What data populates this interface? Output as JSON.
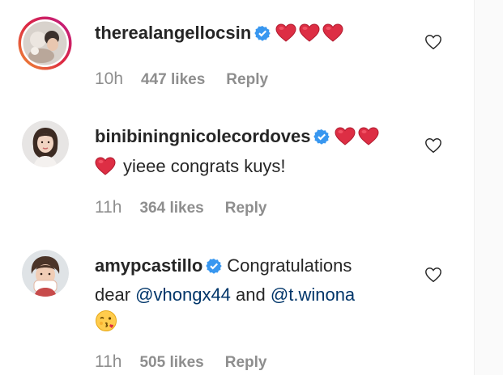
{
  "comments": [
    {
      "username": "therealangellocsin",
      "text": "",
      "time": "10h",
      "likes": "447 likes",
      "reply": "Reply",
      "avatar_icon": "avatar-photo-icon",
      "story_ring": true
    },
    {
      "username": "binibiningnicolecordoves",
      "text": "yieee congrats kuys!",
      "time": "11h",
      "likes": "364 likes",
      "reply": "Reply",
      "avatar_icon": "avatar-photo-icon",
      "story_ring": false
    },
    {
      "username": "amypcastillo",
      "text_1": "Congratulations",
      "text_2": "dear",
      "mention_1": "@vhongx44",
      "text_and": "and",
      "mention_2": "@t.winona",
      "time": "11h",
      "likes": "505 likes",
      "reply": "Reply",
      "avatar_icon": "avatar-photo-icon",
      "story_ring": false
    }
  ],
  "icons": {
    "verified": "verified-badge-icon",
    "heart_emoji": "red-heart-emoji",
    "kiss_emoji": "face-blowing-kiss-emoji",
    "like": "heart-outline-icon"
  },
  "colors": {
    "username": "#262626",
    "meta": "#8e8e8e",
    "mention": "#003569",
    "verified": "#3897f0",
    "heart": "#ed4956",
    "story_ring_start": "#f09433",
    "story_ring_end": "#bc1888"
  }
}
